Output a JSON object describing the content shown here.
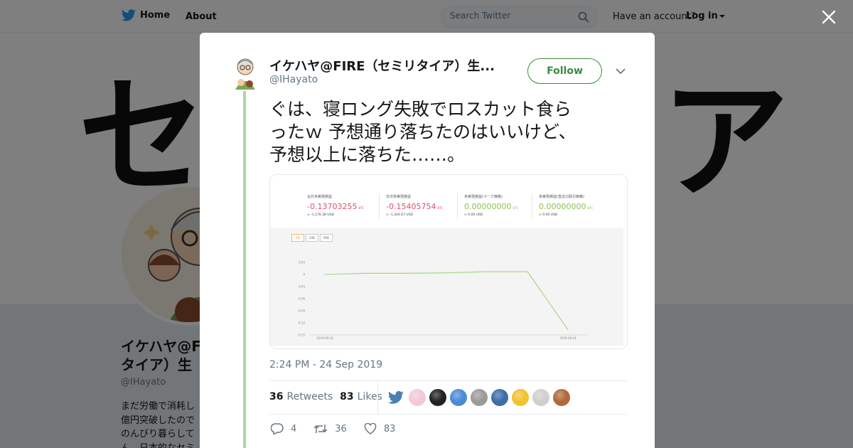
{
  "nav": {
    "home_label": "Home",
    "about_label": "About",
    "search_placeholder": "Search Twitter",
    "have_account": "Have an account?",
    "login_label": "Log in"
  },
  "banner": {
    "left_char": "セ",
    "right_char": "ア"
  },
  "background_profile": {
    "name_line1": "イケハヤ@F",
    "name_line2": "タイア）生",
    "handle": "@IHayato",
    "bio_line1": "まだ労働で消耗し",
    "bio_line2": "億円突破したので",
    "bio_line3": "のんびり暮らして",
    "bio_line4": "ん。日本的なセミ"
  },
  "tweet": {
    "display_name": "イケハヤ@FIRE（セミリタイア）生...",
    "handle": "@IHayato",
    "follow_label": "Follow",
    "text_line1": "ぐは、寝ロング失敗でロスカット食ら",
    "text_line2": "ったｗ 予想通り落ちたのはいいけど、",
    "text_line3": "予想以上に落ちた……。",
    "timestamp": "2:24 PM - 24 Sep 2019",
    "retweets_count": "36",
    "retweets_label": "Retweets",
    "likes_count": "83",
    "likes_label": "Likes",
    "reply_count": "4",
    "retweet_action_count": "36",
    "like_action_count": "83"
  },
  "media": {
    "stats": [
      {
        "label": "合計未実現損益",
        "value": "-0.13703255",
        "unit": "BTC",
        "sub": "≈ -1,176.38 USD",
        "color": "#e0506b"
      },
      {
        "label": "日次未実現損益",
        "value": "-0.15405754",
        "unit": "BTC",
        "sub": "≈ -1,324.67 USD",
        "color": "#e0506b"
      },
      {
        "label": "未実現損益(マーク価格)",
        "value": "0.00000000",
        "unit": "BTC",
        "sub": "≈ 0.00 USD",
        "color": "#8cc152"
      },
      {
        "label": "未実現損益(直近の取引価格)",
        "value": "0.00000000",
        "unit": "BTC",
        "sub": "≈ 0.00 USD",
        "color": "#8cc152"
      }
    ],
    "tabs": [
      "1D",
      "30D",
      "90D"
    ]
  },
  "chart_data": {
    "type": "line",
    "x": [
      "2019-09-18",
      "2019-09-19",
      "2019-09-20",
      "2019-09-21",
      "2019-09-22",
      "2019-09-23",
      "2019-09-24"
    ],
    "series": [
      {
        "values": [
          0.0,
          0.003,
          0.003,
          0.004,
          0.007,
          0.007,
          -0.137
        ]
      }
    ],
    "ylim": [
      -0.15,
      0.03
    ],
    "yticks": [
      "0.03",
      "0",
      "-0.03",
      "-0.06",
      "-0.09",
      "-0.12",
      "-0.15"
    ],
    "xtick_labels": [
      "2019-09-18",
      "2019-09-24"
    ],
    "grid": false,
    "line_color": "#9fd47a"
  },
  "likers": [
    {
      "icon": "bird-liker-icon",
      "color": "#4a7fb5"
    },
    {
      "icon": "anime-avatar-icon",
      "color": "#f2c9d6"
    },
    {
      "icon": "dark-avatar-icon",
      "color": "#222222"
    },
    {
      "icon": "landscape-avatar-icon",
      "color": "#4b8ad6"
    },
    {
      "icon": "cat-avatar-icon",
      "color": "#9a9a9a"
    },
    {
      "icon": "logo-avatar-icon",
      "color": "#3c6ea8"
    },
    {
      "icon": "smiley-avatar-icon",
      "color": "#f2c230"
    },
    {
      "icon": "dog-avatar-icon",
      "color": "#cfcfcf"
    },
    {
      "icon": "person-avatar-icon",
      "color": "#b06a3a"
    }
  ],
  "colors": {
    "accent": "#3b8b3b",
    "thread_line": "#a8d8a0",
    "text_secondary": "#657786"
  }
}
